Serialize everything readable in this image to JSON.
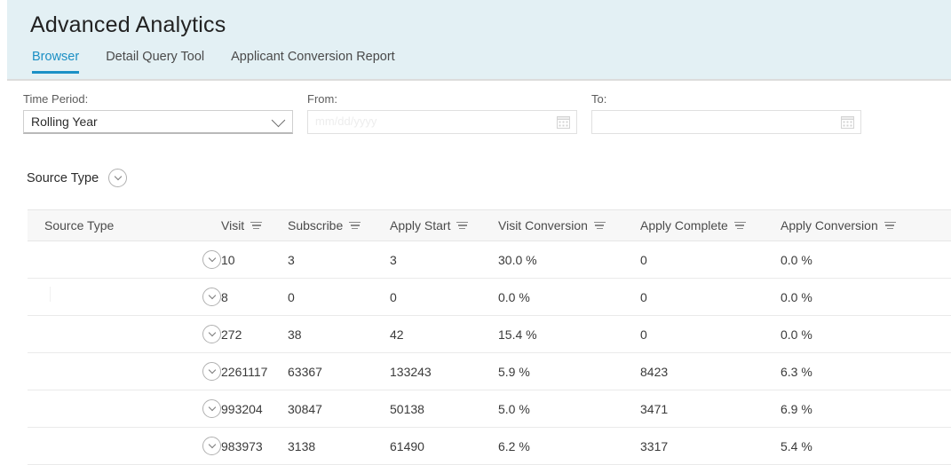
{
  "header": {
    "title": "Advanced Analytics",
    "tabs": [
      {
        "label": "Browser",
        "active": true
      },
      {
        "label": "Detail Query Tool",
        "active": false
      },
      {
        "label": "Applicant Conversion Report",
        "active": false
      }
    ],
    "background_color": "#e3f0f4",
    "active_tab_color": "#1b8fc4"
  },
  "filters": {
    "time_period": {
      "label": "Time Period:",
      "value": "Rolling Year",
      "icon": "chevron-down-icon"
    },
    "from": {
      "label": "From:",
      "value": "",
      "placeholder": "mm/dd/yyyy",
      "icon": "calendar-icon"
    },
    "to": {
      "label": "To:",
      "value": "",
      "placeholder": "",
      "icon": "calendar-icon"
    }
  },
  "group": {
    "label": "Source Type",
    "icon": "chevron-down-circle-icon"
  },
  "table": {
    "columns": [
      {
        "label": "Source Type",
        "sortable": false
      },
      {
        "label": "Visit",
        "sortable": true
      },
      {
        "label": "Subscribe",
        "sortable": true
      },
      {
        "label": "Apply Start",
        "sortable": true
      },
      {
        "label": "Visit Conversion",
        "sortable": true
      },
      {
        "label": "Apply Complete",
        "sortable": true
      },
      {
        "label": "Apply Conversion",
        "sortable": true
      }
    ],
    "rows": [
      {
        "source_type": "",
        "visit": "10",
        "subscribe": "3",
        "apply_start": "3",
        "visit_conversion": "30.0 %",
        "apply_complete": "0",
        "apply_conversion": "0.0 %"
      },
      {
        "source_type": "",
        "visit": "8",
        "subscribe": "0",
        "apply_start": "0",
        "visit_conversion": "0.0 %",
        "apply_complete": "0",
        "apply_conversion": "0.0 %"
      },
      {
        "source_type": "",
        "visit": "272",
        "subscribe": "38",
        "apply_start": "42",
        "visit_conversion": "15.4 %",
        "apply_complete": "0",
        "apply_conversion": "0.0 %"
      },
      {
        "source_type": "",
        "visit": "2261117",
        "subscribe": "63367",
        "apply_start": "133243",
        "visit_conversion": "5.9 %",
        "apply_complete": "8423",
        "apply_conversion": "6.3 %"
      },
      {
        "source_type": "",
        "visit": "993204",
        "subscribe": "30847",
        "apply_start": "50138",
        "visit_conversion": "5.0 %",
        "apply_complete": "3471",
        "apply_conversion": "6.9 %"
      },
      {
        "source_type": "",
        "visit": "983973",
        "subscribe": "3138",
        "apply_start": "61490",
        "visit_conversion": "6.2 %",
        "apply_complete": "3317",
        "apply_conversion": "5.4 %"
      }
    ],
    "row_expand_icon": "chevron-down-circle-icon",
    "link_color": "#1878b9"
  }
}
